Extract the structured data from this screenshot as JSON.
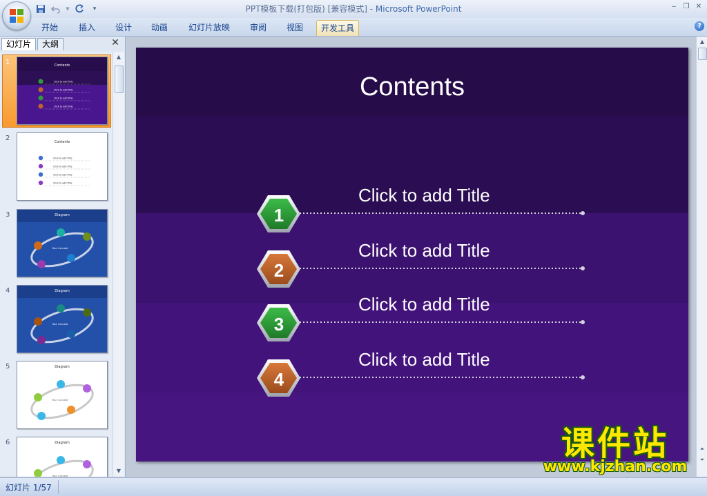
{
  "window": {
    "title": "PPT模板下载(打包版) [兼容模式] - ",
    "app_name": "Microsoft PowerPoint"
  },
  "icons": {
    "office": "office-logo-icon",
    "save": "save-icon",
    "undo": "undo-icon",
    "redo": "redo-icon",
    "customize": "qat-customize-icon",
    "help": "help-icon",
    "close": "close-icon"
  },
  "ribbon": {
    "tabs": [
      {
        "label": "开始"
      },
      {
        "label": "插入"
      },
      {
        "label": "设计"
      },
      {
        "label": "动画"
      },
      {
        "label": "幻灯片放映"
      },
      {
        "label": "审阅"
      },
      {
        "label": "视图"
      },
      {
        "label": "开发工具",
        "active": true
      }
    ]
  },
  "left_pane": {
    "tabs": [
      {
        "label": "幻灯片",
        "active": true
      },
      {
        "label": "大纲"
      }
    ],
    "thumbnails": [
      {
        "number": "1",
        "title": "Contents",
        "selected": true
      },
      {
        "number": "2",
        "title": "Contents"
      },
      {
        "number": "3",
        "title": "Diagram"
      },
      {
        "number": "4",
        "title": "Diagram"
      },
      {
        "number": "5",
        "title": "Diagram"
      },
      {
        "number": "6",
        "title": "Diagram"
      }
    ]
  },
  "slide": {
    "title": "Contents",
    "items": [
      {
        "number": "1",
        "label": "Click to add Title",
        "color": "#2f9a3a"
      },
      {
        "number": "2",
        "label": "Click to add Title",
        "color": "#c0642a"
      },
      {
        "number": "3",
        "label": "Click to add Title",
        "color": "#2f9a3a"
      },
      {
        "number": "4",
        "label": "Click to add Title",
        "color": "#c0642a"
      }
    ]
  },
  "status": {
    "slide_indicator": "幻灯片 1/57"
  },
  "watermark": {
    "main": "课件站",
    "url": "www.kjzhan.com"
  },
  "colors": {
    "slide_bg": "#42137a",
    "slide_dark": "#280d4c",
    "green": "#2f9a3a",
    "orange": "#c0642a"
  }
}
